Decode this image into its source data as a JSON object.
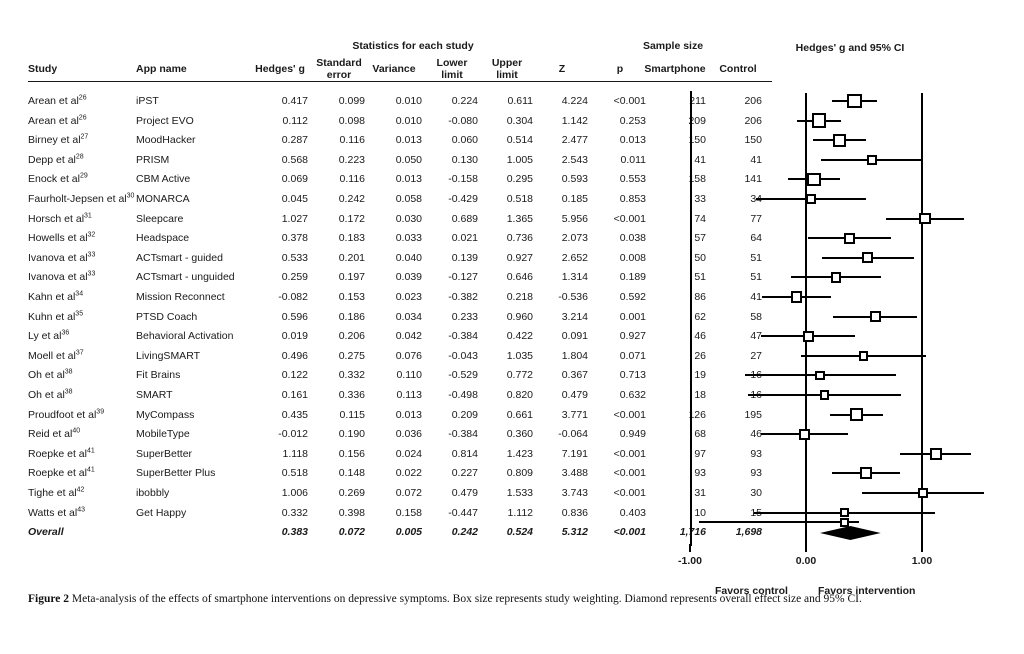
{
  "table": {
    "group_headers": [
      {
        "label": "Statistics for each study"
      },
      {
        "label": "Sample size"
      }
    ],
    "columns": [
      {
        "key": "study",
        "label": "Study"
      },
      {
        "key": "app",
        "label": "App name"
      },
      {
        "key": "g",
        "label": "Hedges' g"
      },
      {
        "key": "se",
        "label": "Standard error"
      },
      {
        "key": "var",
        "label": "Variance"
      },
      {
        "key": "lower",
        "label": "Lower limit"
      },
      {
        "key": "upper",
        "label": "Upper limit"
      },
      {
        "key": "z",
        "label": "Z"
      },
      {
        "key": "p",
        "label": "p"
      },
      {
        "key": "smartphone",
        "label": "Smartphone"
      },
      {
        "key": "control",
        "label": "Control"
      }
    ],
    "rows": [
      {
        "study": "Arean et al",
        "ref": "26",
        "app": "iPST",
        "g": "0.417",
        "se": "0.099",
        "var": "0.010",
        "lower": "0.224",
        "upper": "0.611",
        "z": "4.224",
        "p": "<0.001",
        "smartphone": "211",
        "control": "206"
      },
      {
        "study": "Arean et al",
        "ref": "26",
        "app": "Project EVO",
        "g": "0.112",
        "se": "0.098",
        "var": "0.010",
        "lower": "-0.080",
        "upper": "0.304",
        "z": "1.142",
        "p": "0.253",
        "smartphone": "209",
        "control": "206"
      },
      {
        "study": "Birney et al",
        "ref": "27",
        "app": "MoodHacker",
        "g": "0.287",
        "se": "0.116",
        "var": "0.013",
        "lower": "0.060",
        "upper": "0.514",
        "z": "2.477",
        "p": "0.013",
        "smartphone": "150",
        "control": "150"
      },
      {
        "study": "Depp et al",
        "ref": "28",
        "app": "PRISM",
        "g": "0.568",
        "se": "0.223",
        "var": "0.050",
        "lower": "0.130",
        "upper": "1.005",
        "z": "2.543",
        "p": "0.011",
        "smartphone": "41",
        "control": "41"
      },
      {
        "study": "Enock et al",
        "ref": "29",
        "app": "CBM Active",
        "g": "0.069",
        "se": "0.116",
        "var": "0.013",
        "lower": "-0.158",
        "upper": "0.295",
        "z": "0.593",
        "p": "0.553",
        "smartphone": "158",
        "control": "141"
      },
      {
        "study": "Faurholt-Jepsen et al",
        "ref": "30",
        "app": "MONARCA",
        "g": "0.045",
        "se": "0.242",
        "var": "0.058",
        "lower": "-0.429",
        "upper": "0.518",
        "z": "0.185",
        "p": "0.853",
        "smartphone": "33",
        "control": "34"
      },
      {
        "study": "Horsch et al",
        "ref": "31",
        "app": "Sleepcare",
        "g": "1.027",
        "se": "0.172",
        "var": "0.030",
        "lower": "0.689",
        "upper": "1.365",
        "z": "5.956",
        "p": "<0.001",
        "smartphone": "74",
        "control": "77"
      },
      {
        "study": "Howells et al",
        "ref": "32",
        "app": "Headspace",
        "g": "0.378",
        "se": "0.183",
        "var": "0.033",
        "lower": "0.021",
        "upper": "0.736",
        "z": "2.073",
        "p": "0.038",
        "smartphone": "57",
        "control": "64"
      },
      {
        "study": "Ivanova et al",
        "ref": "33",
        "app": "ACTsmart - guided",
        "g": "0.533",
        "se": "0.201",
        "var": "0.040",
        "lower": "0.139",
        "upper": "0.927",
        "z": "2.652",
        "p": "0.008",
        "smartphone": "50",
        "control": "51"
      },
      {
        "study": "Ivanova et al",
        "ref": "33",
        "app": "ACTsmart - unguided",
        "g": "0.259",
        "se": "0.197",
        "var": "0.039",
        "lower": "-0.127",
        "upper": "0.646",
        "z": "1.314",
        "p": "0.189",
        "smartphone": "51",
        "control": "51"
      },
      {
        "study": "Kahn et al",
        "ref": "34",
        "app": "Mission Reconnect",
        "g": "-0.082",
        "se": "0.153",
        "var": "0.023",
        "lower": "-0.382",
        "upper": "0.218",
        "z": "-0.536",
        "p": "0.592",
        "smartphone": "86",
        "control": "41"
      },
      {
        "study": "Kuhn et al",
        "ref": "35",
        "app": "PTSD Coach",
        "g": "0.596",
        "se": "0.186",
        "var": "0.034",
        "lower": "0.233",
        "upper": "0.960",
        "z": "3.214",
        "p": "0.001",
        "smartphone": "62",
        "control": "58"
      },
      {
        "study": "Ly et al",
        "ref": "36",
        "app": "Behavioral Activation",
        "g": "0.019",
        "se": "0.206",
        "var": "0.042",
        "lower": "-0.384",
        "upper": "0.422",
        "z": "0.091",
        "p": "0.927",
        "smartphone": "46",
        "control": "47"
      },
      {
        "study": "Moell et al",
        "ref": "37",
        "app": "LivingSMART",
        "g": "0.496",
        "se": "0.275",
        "var": "0.076",
        "lower": "-0.043",
        "upper": "1.035",
        "z": "1.804",
        "p": "0.071",
        "smartphone": "26",
        "control": "27"
      },
      {
        "study": "Oh et al",
        "ref": "38",
        "app": "Fit Brains",
        "g": "0.122",
        "se": "0.332",
        "var": "0.110",
        "lower": "-0.529",
        "upper": "0.772",
        "z": "0.367",
        "p": "0.713",
        "smartphone": "19",
        "control": "16"
      },
      {
        "study": "Oh et al",
        "ref": "38",
        "app": "SMART",
        "g": "0.161",
        "se": "0.336",
        "var": "0.113",
        "lower": "-0.498",
        "upper": "0.820",
        "z": "0.479",
        "p": "0.632",
        "smartphone": "18",
        "control": "16"
      },
      {
        "study": "Proudfoot et al",
        "ref": "39",
        "app": "MyCompass",
        "g": "0.435",
        "se": "0.115",
        "var": "0.013",
        "lower": "0.209",
        "upper": "0.661",
        "z": "3.771",
        "p": "<0.001",
        "smartphone": "126",
        "control": "195"
      },
      {
        "study": "Reid et al",
        "ref": "40",
        "app": "MobileType",
        "g": "-0.012",
        "se": "0.190",
        "var": "0.036",
        "lower": "-0.384",
        "upper": "0.360",
        "z": "-0.064",
        "p": "0.949",
        "smartphone": "68",
        "control": "46"
      },
      {
        "study": "Roepke et al",
        "ref": "41",
        "app": "SuperBetter",
        "g": "1.118",
        "se": "0.156",
        "var": "0.024",
        "lower": "0.814",
        "upper": "1.423",
        "z": "7.191",
        "p": "<0.001",
        "smartphone": "97",
        "control": "93"
      },
      {
        "study": "Roepke et al",
        "ref": "41",
        "app": "SuperBetter Plus",
        "g": "0.518",
        "se": "0.148",
        "var": "0.022",
        "lower": "0.227",
        "upper": "0.809",
        "z": "3.488",
        "p": "<0.001",
        "smartphone": "93",
        "control": "93"
      },
      {
        "study": "Tighe et al",
        "ref": "42",
        "app": "ibobbly",
        "g": "1.006",
        "se": "0.269",
        "var": "0.072",
        "lower": "0.479",
        "upper": "1.533",
        "z": "3.743",
        "p": "<0.001",
        "smartphone": "31",
        "control": "30"
      },
      {
        "study": "Watts et al",
        "ref": "43",
        "app": "Get Happy",
        "g": "0.332",
        "se": "0.398",
        "var": "0.158",
        "lower": "-0.447",
        "upper": "1.112",
        "z": "0.836",
        "p": "0.403",
        "smartphone": "10",
        "control": "15"
      },
      {
        "study": "Overall",
        "ref": "",
        "app": "",
        "g": "0.383",
        "se": "0.072",
        "var": "0.005",
        "lower": "0.242",
        "upper": "0.524",
        "z": "5.312",
        "p": "<0.001",
        "smartphone": "1,716",
        "control": "1,698",
        "is_overall": true
      }
    ]
  },
  "plot": {
    "title": "Hedges' g and 95% CI",
    "axis": {
      "ticks": [
        {
          "value": -1.0,
          "label": "-1.00"
        },
        {
          "value": 0.0,
          "label": "0.00"
        },
        {
          "value": 1.0,
          "label": "1.00"
        }
      ],
      "min": -1.35,
      "max": 1.55,
      "reference_lines": [
        0.0,
        1.0
      ]
    },
    "favors_left_label": "Favors control",
    "favors_right_label": "Favors intervention"
  },
  "caption": {
    "figure_label": "Figure 2",
    "text": "Meta-analysis of the effects of smartphone interventions on depressive symptoms. Box size represents study weighting. Diamond represents overall effect size and 95% CI."
  },
  "chart_data": {
    "type": "forest",
    "title": "Hedges' g and 95% CI",
    "xlabel": "Hedges' g",
    "xlim": [
      -1.35,
      1.55
    ],
    "xticks": [
      -1.0,
      0.0,
      1.0
    ],
    "reference_lines": [
      0.0,
      1.0
    ],
    "effect_measure": "Hedges' g",
    "studies": [
      {
        "label": "Arean et al 26 - iPST",
        "g": 0.417,
        "se": 0.099,
        "variance": 0.01,
        "lower": 0.224,
        "upper": 0.611,
        "z": 4.224,
        "p": "<0.001",
        "n_smartphone": 211,
        "n_control": 206,
        "weight": 0.82
      },
      {
        "label": "Arean et al 26 - Project EVO",
        "g": 0.112,
        "se": 0.098,
        "variance": 0.01,
        "lower": -0.08,
        "upper": 0.304,
        "z": 1.142,
        "p": "0.253",
        "n_smartphone": 209,
        "n_control": 206,
        "weight": 0.83
      },
      {
        "label": "Birney et al 27 - MoodHacker",
        "g": 0.287,
        "se": 0.116,
        "variance": 0.013,
        "lower": 0.06,
        "upper": 0.514,
        "z": 2.477,
        "p": "0.013",
        "n_smartphone": 150,
        "n_control": 150,
        "weight": 0.7
      },
      {
        "label": "Depp et al 28 - PRISM",
        "g": 0.568,
        "se": 0.223,
        "variance": 0.05,
        "lower": 0.13,
        "upper": 1.005,
        "z": 2.543,
        "p": "0.011",
        "n_smartphone": 41,
        "n_control": 41,
        "weight": 0.38
      },
      {
        "label": "Enock et al 29 - CBM Active",
        "g": 0.069,
        "se": 0.116,
        "variance": 0.013,
        "lower": -0.158,
        "upper": 0.295,
        "z": 0.593,
        "p": "0.553",
        "n_smartphone": 158,
        "n_control": 141,
        "weight": 0.7
      },
      {
        "label": "Faurholt-Jepsen et al 30 - MONARCA",
        "g": 0.045,
        "se": 0.242,
        "variance": 0.058,
        "lower": -0.429,
        "upper": 0.518,
        "z": 0.185,
        "p": "0.853",
        "n_smartphone": 33,
        "n_control": 34,
        "weight": 0.35
      },
      {
        "label": "Horsch et al 31 - Sleepcare",
        "g": 1.027,
        "se": 0.172,
        "variance": 0.03,
        "lower": 0.689,
        "upper": 1.365,
        "z": 5.956,
        "p": "<0.001",
        "n_smartphone": 74,
        "n_control": 77,
        "weight": 0.49
      },
      {
        "label": "Howells et al 32 - Headspace",
        "g": 0.378,
        "se": 0.183,
        "variance": 0.033,
        "lower": 0.021,
        "upper": 0.736,
        "z": 2.073,
        "p": "0.038",
        "n_smartphone": 57,
        "n_control": 64,
        "weight": 0.46
      },
      {
        "label": "Ivanova et al 33 - ACTsmart - guided",
        "g": 0.533,
        "se": 0.201,
        "variance": 0.04,
        "lower": 0.139,
        "upper": 0.927,
        "z": 2.652,
        "p": "0.008",
        "n_smartphone": 50,
        "n_control": 51,
        "weight": 0.42
      },
      {
        "label": "Ivanova et al 33 - ACTsmart - unguided",
        "g": 0.259,
        "se": 0.197,
        "variance": 0.039,
        "lower": -0.127,
        "upper": 0.646,
        "z": 1.314,
        "p": "0.189",
        "n_smartphone": 51,
        "n_control": 51,
        "weight": 0.43
      },
      {
        "label": "Kahn et al 34 - Mission Reconnect",
        "g": -0.082,
        "se": 0.153,
        "variance": 0.023,
        "lower": -0.382,
        "upper": 0.218,
        "z": -0.536,
        "p": "0.592",
        "n_smartphone": 86,
        "n_control": 41,
        "weight": 0.55
      },
      {
        "label": "Kuhn et al 35 - PTSD Coach",
        "g": 0.596,
        "se": 0.186,
        "variance": 0.034,
        "lower": 0.233,
        "upper": 0.96,
        "z": 3.214,
        "p": "0.001",
        "n_smartphone": 62,
        "n_control": 58,
        "weight": 0.45
      },
      {
        "label": "Ly et al 36 - Behavioral Activation",
        "g": 0.019,
        "se": 0.206,
        "variance": 0.042,
        "lower": -0.384,
        "upper": 0.422,
        "z": 0.091,
        "p": "0.927",
        "n_smartphone": 46,
        "n_control": 47,
        "weight": 0.41
      },
      {
        "label": "Moell et al 37 - LivingSMART",
        "g": 0.496,
        "se": 0.275,
        "variance": 0.076,
        "lower": -0.043,
        "upper": 1.035,
        "z": 1.804,
        "p": "0.071",
        "n_smartphone": 26,
        "n_control": 27,
        "weight": 0.31
      },
      {
        "label": "Oh et al 38 - Fit Brains",
        "g": 0.122,
        "se": 0.332,
        "variance": 0.11,
        "lower": -0.529,
        "upper": 0.772,
        "z": 0.367,
        "p": "0.713",
        "n_smartphone": 19,
        "n_control": 16,
        "weight": 0.26
      },
      {
        "label": "Oh et al 38 - SMART",
        "g": 0.161,
        "se": 0.336,
        "variance": 0.113,
        "lower": -0.498,
        "upper": 0.82,
        "z": 0.479,
        "p": "0.632",
        "n_smartphone": 18,
        "n_control": 16,
        "weight": 0.26
      },
      {
        "label": "Proudfoot et al 39 - MyCompass",
        "g": 0.435,
        "se": 0.115,
        "variance": 0.013,
        "lower": 0.209,
        "upper": 0.661,
        "z": 3.771,
        "p": "<0.001",
        "n_smartphone": 126,
        "n_control": 195,
        "weight": 0.71
      },
      {
        "label": "Reid et al 40 - MobileType",
        "g": -0.012,
        "se": 0.19,
        "variance": 0.036,
        "lower": -0.384,
        "upper": 0.36,
        "z": -0.064,
        "p": "0.949",
        "n_smartphone": 68,
        "n_control": 46,
        "weight": 0.44
      },
      {
        "label": "Roepke et al 41 - SuperBetter",
        "g": 1.118,
        "se": 0.156,
        "variance": 0.024,
        "lower": 0.814,
        "upper": 1.423,
        "z": 7.191,
        "p": "<0.001",
        "n_smartphone": 97,
        "n_control": 93,
        "weight": 0.54
      },
      {
        "label": "Roepke et al 41 - SuperBetter Plus",
        "g": 0.518,
        "se": 0.148,
        "variance": 0.022,
        "lower": 0.227,
        "upper": 0.809,
        "z": 3.488,
        "p": "<0.001",
        "n_smartphone": 93,
        "n_control": 93,
        "weight": 0.57
      },
      {
        "label": "Tighe et al 42 - ibobbly",
        "g": 1.006,
        "se": 0.269,
        "variance": 0.072,
        "lower": 0.479,
        "upper": 1.533,
        "z": 3.743,
        "p": "<0.001",
        "n_smartphone": 31,
        "n_control": 30,
        "weight": 0.32
      },
      {
        "label": "Watts et al 43 - Get Happy",
        "g": 0.332,
        "se": 0.398,
        "variance": 0.158,
        "lower": -0.447,
        "upper": 1.112,
        "z": 0.836,
        "p": "0.403",
        "n_smartphone": 10,
        "n_control": 15,
        "weight": 0.23
      }
    ],
    "overall": {
      "label": "Overall",
      "g": 0.383,
      "se": 0.072,
      "variance": 0.005,
      "lower": 0.242,
      "upper": 0.524,
      "z": 5.312,
      "p": "<0.001",
      "n_smartphone": 1716,
      "n_control": 1698
    }
  }
}
